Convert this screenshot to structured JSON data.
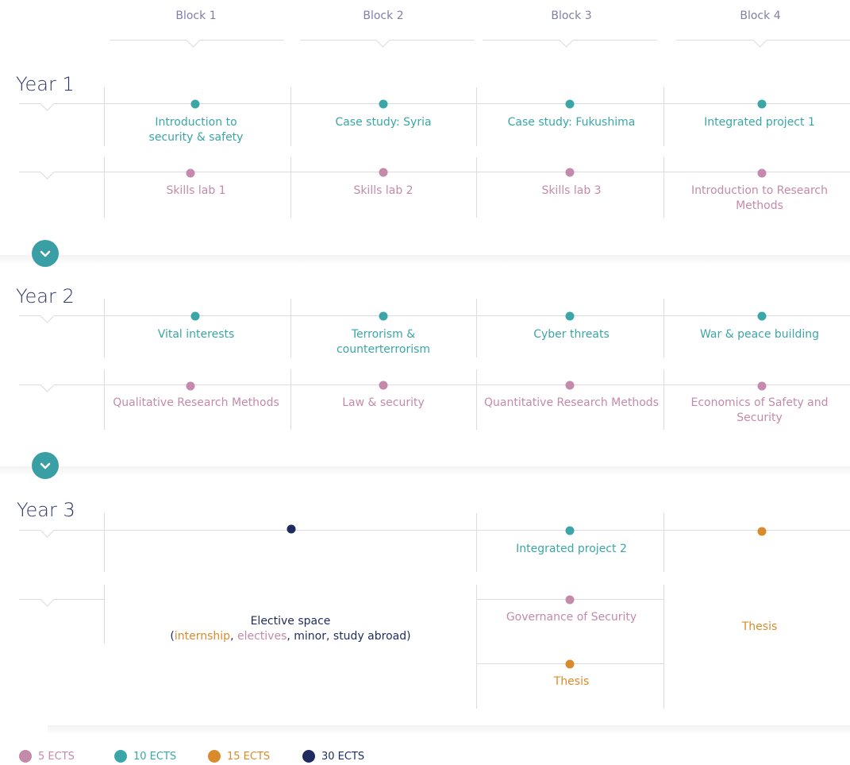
{
  "blocks": [
    "Block 1",
    "Block 2",
    "Block 3",
    "Block 4"
  ],
  "years": [
    {
      "title": "Year 1",
      "rows": [
        [
          {
            "label": "Introduction to\nsecurity & safety",
            "ects": 10
          },
          {
            "label": "Case study: Syria",
            "ects": 10
          },
          {
            "label": "Case study: Fukushima",
            "ects": 10
          },
          {
            "label": "Integrated project 1",
            "ects": 10
          }
        ],
        [
          {
            "label": "Skills lab 1",
            "ects": 5
          },
          {
            "label": "Skills lab 2",
            "ects": 5
          },
          {
            "label": "Skills lab 3",
            "ects": 5
          },
          {
            "label": "Introduction to Research\nMethods",
            "ects": 5
          }
        ]
      ]
    },
    {
      "title": "Year 2",
      "rows": [
        [
          {
            "label": "Vital interests",
            "ects": 10
          },
          {
            "label": "Terrorism &\ncounterterrorism",
            "ects": 10
          },
          {
            "label": "Cyber threats",
            "ects": 10
          },
          {
            "label": "War & peace building",
            "ects": 10
          }
        ],
        [
          {
            "label": "Qualitative Research Methods",
            "ects": 5
          },
          {
            "label": "Law & security",
            "ects": 5
          },
          {
            "label": "Quantitative Research Methods",
            "ects": 5
          },
          {
            "label": "Economics of Safety and Security",
            "ects": 5
          }
        ]
      ]
    },
    {
      "title": "Year 3",
      "elective": {
        "title": "Elective space",
        "open": "(",
        "internship": "internship",
        "sep1": ", ",
        "electives": "electives",
        "rest": ", minor, study abroad)",
        "ects": 30
      },
      "integrated": {
        "label": "Integrated project 2",
        "ects": 10
      },
      "governance": {
        "label": "Governance of Security",
        "ects": 5
      },
      "thesis_b3": {
        "label": "Thesis",
        "ects": 15
      },
      "thesis_b4": {
        "label": "Thesis",
        "ects": 15
      }
    }
  ],
  "legend": [
    {
      "label": "5 ECTS",
      "color": "#c48aaa"
    },
    {
      "label": "10 ECTS",
      "color": "#3aa6a8"
    },
    {
      "label": "15 ECTS",
      "color": "#d98b2b"
    },
    {
      "label": "30 ECTS",
      "color": "#1e2b5e"
    }
  ],
  "colors": {
    "5": "#c48aaa",
    "10": "#3aa6a8",
    "15": "#d98b2b",
    "30": "#1e2b5e"
  },
  "icons": {
    "expand": "chevron-down-icon"
  }
}
